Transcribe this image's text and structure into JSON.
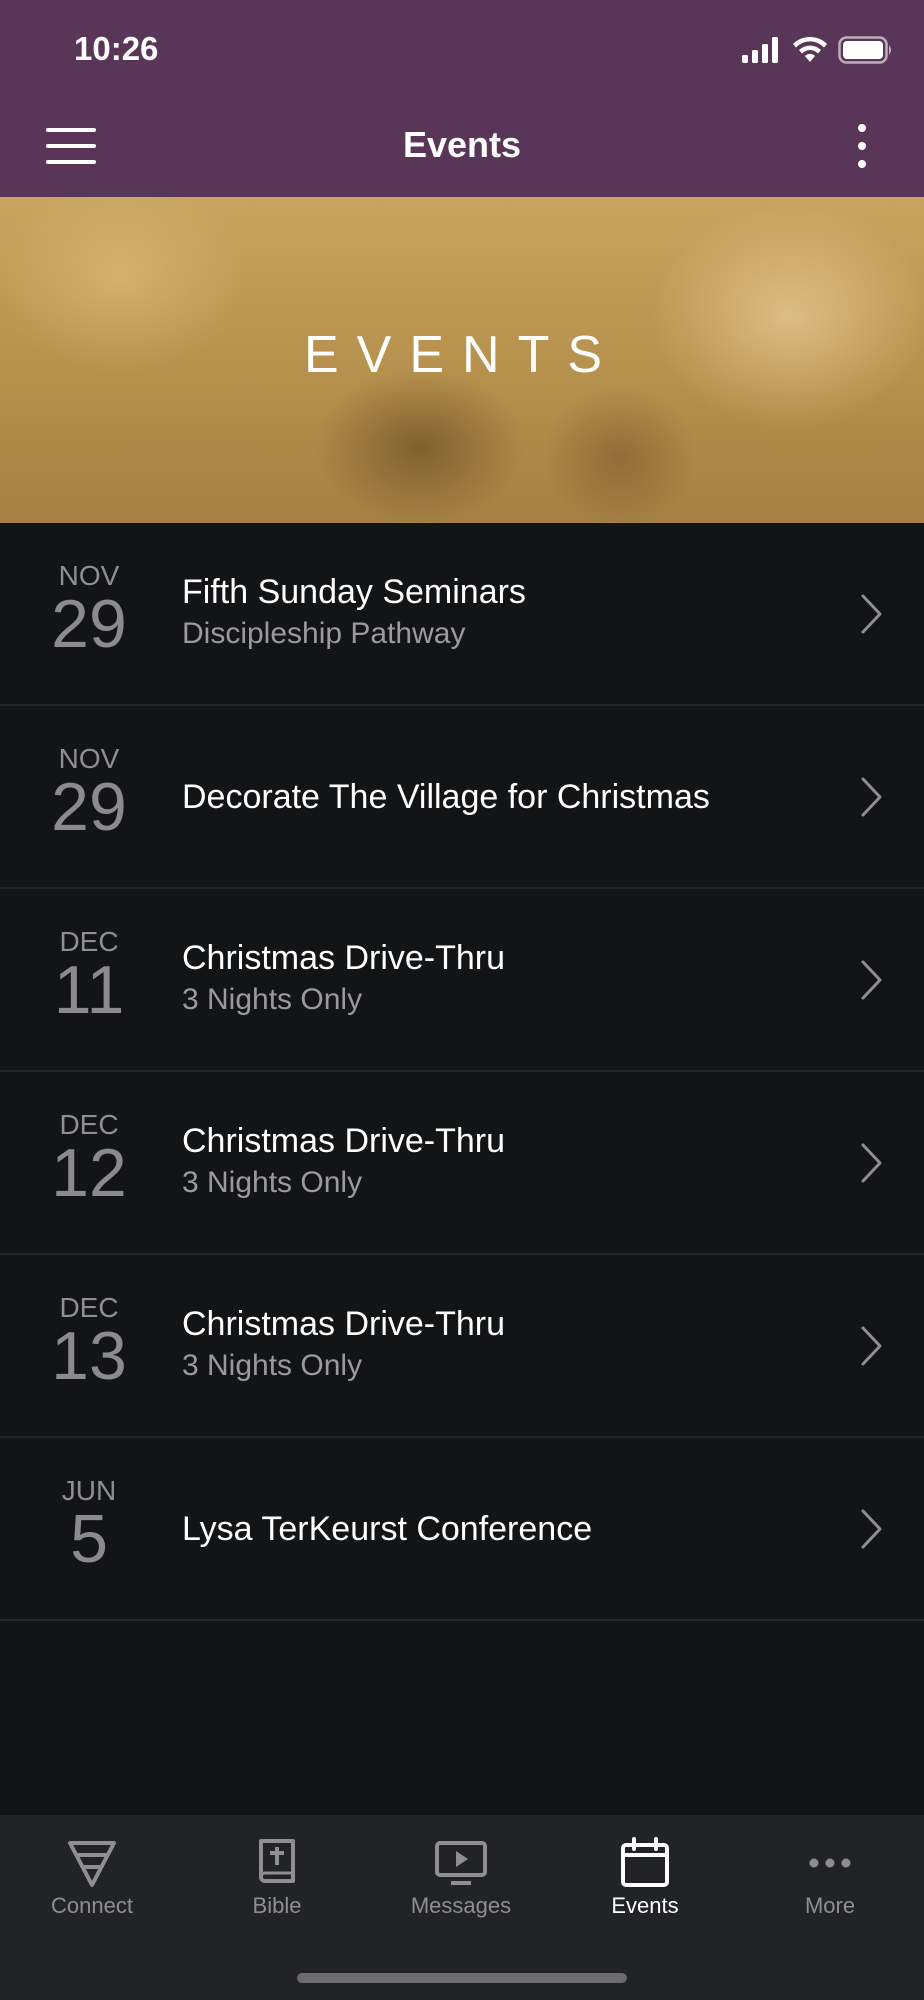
{
  "status_bar": {
    "time": "10:26"
  },
  "nav": {
    "title": "Events"
  },
  "hero": {
    "title": "EVENTS"
  },
  "events": [
    {
      "month": "NOV",
      "day": "29",
      "title": "Fifth Sunday Seminars",
      "subtitle": "Discipleship Pathway"
    },
    {
      "month": "NOV",
      "day": "29",
      "title": "Decorate The Village for Christmas",
      "subtitle": ""
    },
    {
      "month": "DEC",
      "day": "11",
      "title": "Christmas Drive-Thru",
      "subtitle": "3 Nights Only"
    },
    {
      "month": "DEC",
      "day": "12",
      "title": "Christmas Drive-Thru",
      "subtitle": "3 Nights Only"
    },
    {
      "month": "DEC",
      "day": "13",
      "title": "Christmas Drive-Thru",
      "subtitle": "3 Nights Only"
    },
    {
      "month": "JUN",
      "day": "5",
      "title": "Lysa TerKeurst Conference",
      "subtitle": ""
    }
  ],
  "tabs": [
    {
      "label": "Connect",
      "icon": "connect-icon",
      "active": false
    },
    {
      "label": "Bible",
      "icon": "bible-icon",
      "active": false
    },
    {
      "label": "Messages",
      "icon": "messages-icon",
      "active": false
    },
    {
      "label": "Events",
      "icon": "calendar-icon",
      "active": true
    },
    {
      "label": "More",
      "icon": "more-icon",
      "active": false
    }
  ],
  "colors": {
    "header": "#593657",
    "background": "#131416",
    "tabbar": "#222326",
    "hero_tint": "#c9a461"
  }
}
